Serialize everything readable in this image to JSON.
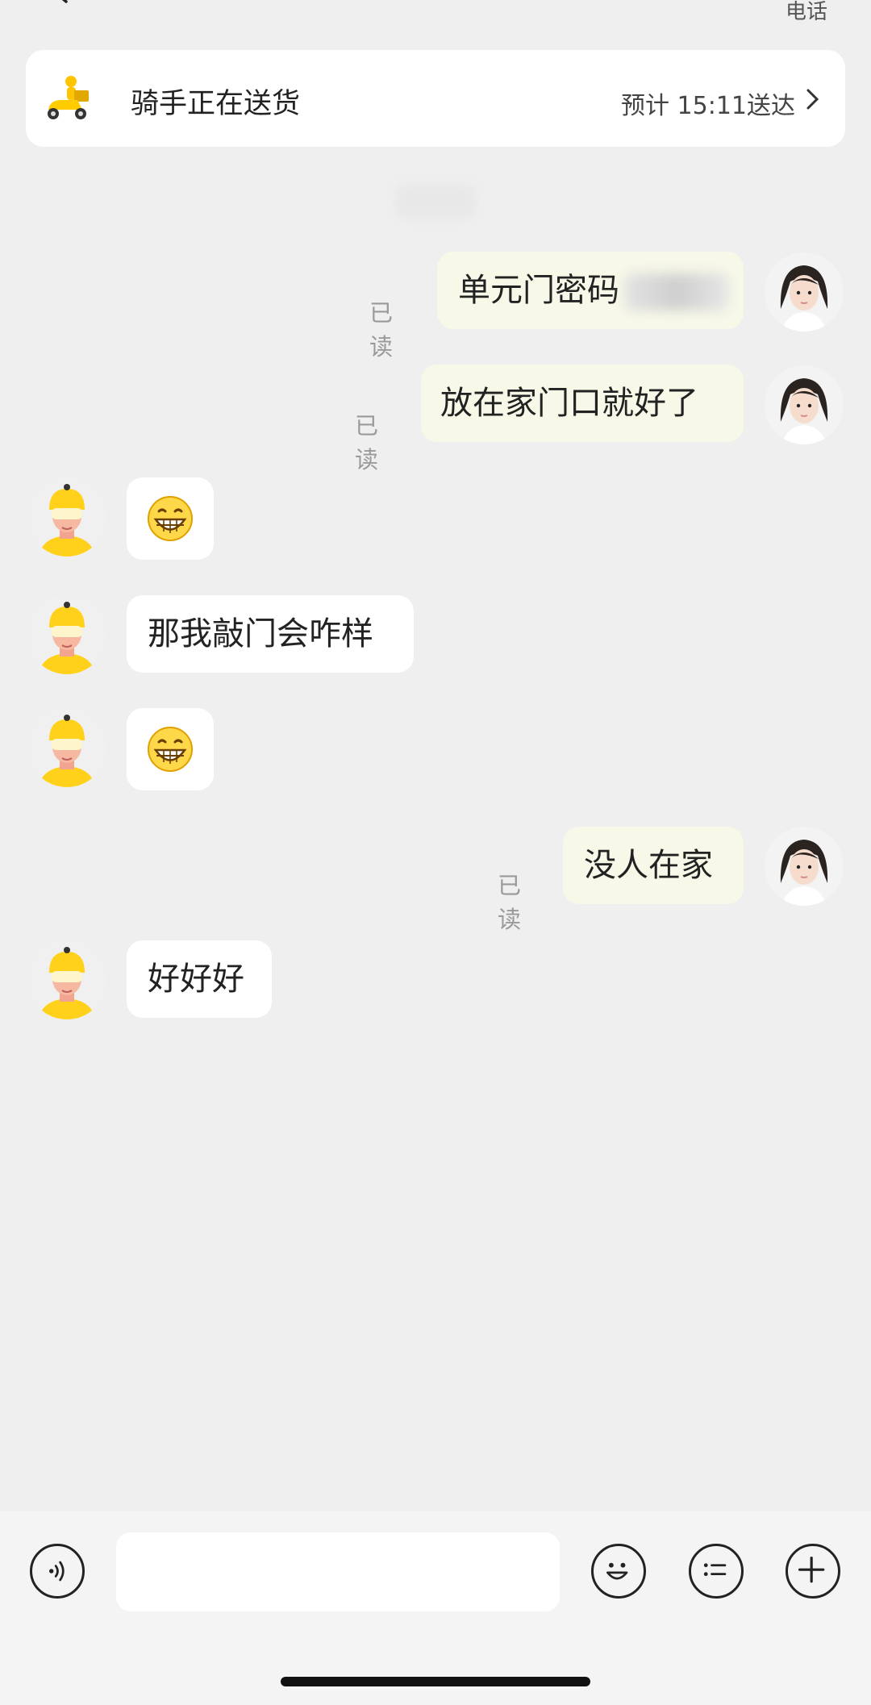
{
  "header": {
    "phone_label": "电话"
  },
  "status_card": {
    "status": "骑手正在送货",
    "eta": "预计 15:11送达"
  },
  "messages": [
    {
      "side": "out",
      "text": "单元门密码",
      "read_label": "已读",
      "note": "password redacted"
    },
    {
      "side": "out",
      "text": "放在家门口就好了",
      "read_label": "已读"
    },
    {
      "side": "in",
      "emoji": "grin"
    },
    {
      "side": "in",
      "text": "那我敲门会咋样"
    },
    {
      "side": "in",
      "emoji": "grin"
    },
    {
      "side": "out",
      "text": "没人在家",
      "read_label": "已读"
    },
    {
      "side": "in",
      "text": "好好好"
    }
  ],
  "input_bar": {
    "placeholder": "",
    "icons": [
      "voice-icon",
      "emoji-icon",
      "quick-reply-icon",
      "plus-icon"
    ]
  },
  "colors": {
    "background": "#efefef",
    "outgoing_bubble": "#f7f8e8",
    "incoming_bubble": "#ffffff",
    "rider_yellow": "#ffd11a"
  }
}
